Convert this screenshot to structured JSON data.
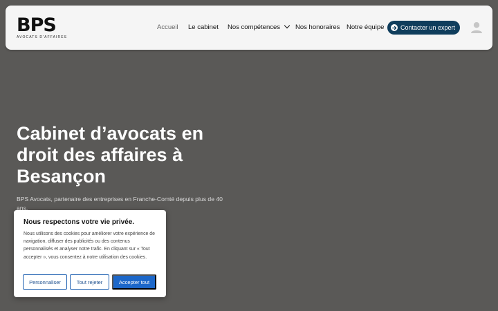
{
  "brand": {
    "mark": "BPS",
    "tagline": "AVOCATS D'AFFAIRES"
  },
  "nav": {
    "items": [
      {
        "label": "Accueil"
      },
      {
        "label": "Le cabinet"
      },
      {
        "label": "Nos compétences"
      },
      {
        "label": "Nos honoraires"
      },
      {
        "label": "Notre équipe"
      }
    ],
    "cta_label": "Contacter un expert"
  },
  "hero": {
    "title": "Cabinet d’avocats en droit des affaires à Besançon",
    "subtitle": "BPS Avocats, partenaire des entreprises en Franche-Comté depuis plus de 40 ans."
  },
  "cookie": {
    "title": "Nous respectons votre vie privée.",
    "text": "Nous utilisons des cookies pour améliorer votre expérience de navigation, diffuser des publicités ou des contenus personnalisés et analyser notre trafic. En cliquant sur « Tout accepter », vous consentez à notre utilisation des cookies.",
    "customize": "Personnaliser",
    "reject": "Tout rejeter",
    "accept": "Accepter tout"
  },
  "colors": {
    "hero_background": "#5a5957",
    "cta_background": "#0f3d5c",
    "accept_button": "#1c67c9"
  },
  "icons": {
    "cta": "arrow-right-circle-icon",
    "account": "user-icon",
    "dropdown": "chevron-down-icon"
  }
}
